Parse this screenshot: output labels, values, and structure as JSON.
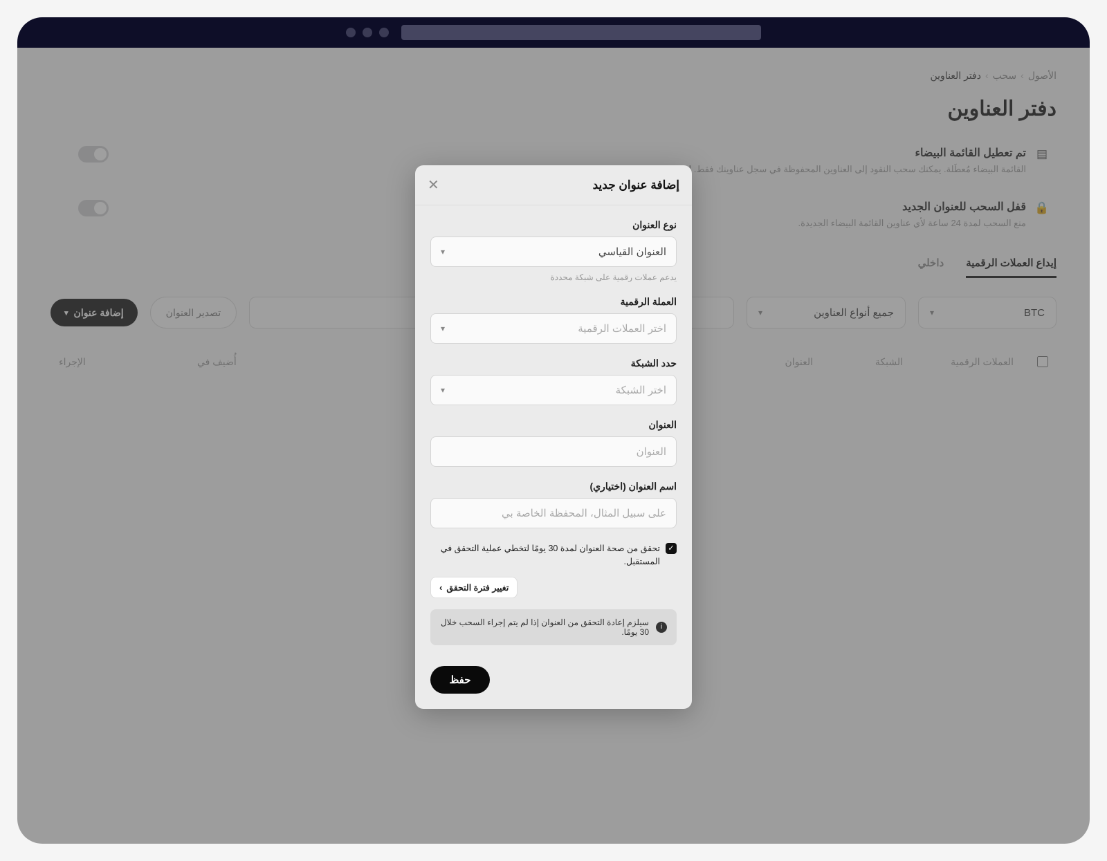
{
  "breadcrumbs": {
    "a": "الأصول",
    "b": "سحب",
    "c": "دفتر العناوين"
  },
  "pageTitle": "دفتر العناوين",
  "panel1": {
    "title": "تم تعطيل القائمة البيضاء",
    "desc": "القائمة البيضاء مُعطَلة. يمكنك سحب النقود إلى العناوين المحفوظة في سجل عناوينك فقط.",
    "link": "اعرف"
  },
  "panel2": {
    "title": "قفل السحب للعنوان الجديد",
    "desc": "منع السحب لمدة 24 ساعة لأي عناوين القائمة البيضاء الجديدة."
  },
  "tabs": {
    "t1": "إيداع العملات الرقمية",
    "t2": "داخلي"
  },
  "filters": {
    "coin": "BTC",
    "types": "جميع أنواع العناوين",
    "searchPH": "",
    "export": "تصدير العنوان",
    "add": "إضافة عنوان"
  },
  "table": {
    "c1": "العملات الرقمية",
    "c2": "الشبكة",
    "c3": "العنوان",
    "c4": "أُضيف في",
    "c5": "الإجراء"
  },
  "modal": {
    "title": "إضافة عنوان جديد",
    "addrTypeLabel": "نوع العنوان",
    "addrTypeValue": "العنوان القياسي",
    "addrTypeHint": "يدعم عملات رقمية على شبكة محددة",
    "coinLabel": "العملة الرقمية",
    "coinPH": "اختر العملات الرقمية",
    "netLabel": "حدد الشبكة",
    "netPH": "اختر الشبكة",
    "addrLabel": "العنوان",
    "addrPH": "العنوان",
    "nameLabel": "اسم العنوان (اختياري)",
    "namePH": "على سبيل المثال، المحفظة الخاصة بي",
    "checkText": "تحقق من صحة العنوان لمدة 30 يومًا لتخطي عملية التحقق في المستقبل.",
    "changePeriod": "تغيير فترة التحقق",
    "infoText": "سيلزم إعادة التحقق من العنوان إذا لم يتم إجراء السحب خلال 30 يومًا.",
    "save": "حفظ"
  }
}
